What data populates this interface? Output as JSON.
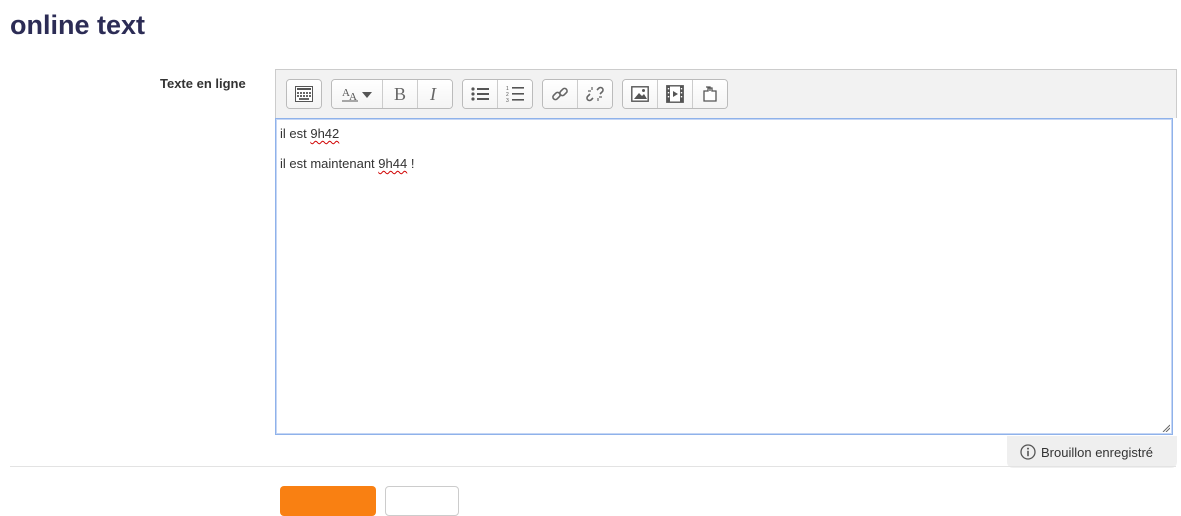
{
  "page": {
    "title": "online text"
  },
  "form": {
    "field_label": "Texte en ligne"
  },
  "editor": {
    "toolbar": [
      {
        "group": "more",
        "buttons": [
          "show-more-buttons-icon"
        ]
      },
      {
        "group": "style",
        "buttons": [
          "paragraph-styles-icon",
          "bold-icon",
          "italic-icon"
        ]
      },
      {
        "group": "list",
        "buttons": [
          "unordered-list-icon",
          "ordered-list-icon"
        ]
      },
      {
        "group": "links",
        "buttons": [
          "link-icon",
          "unlink-icon"
        ]
      },
      {
        "group": "files",
        "buttons": [
          "image-icon",
          "media-icon",
          "manage-files-icon"
        ]
      }
    ],
    "lines": [
      {
        "prefix": "il est ",
        "misspelled": "9h42",
        "suffix": ""
      },
      {
        "prefix": "il est maintenant ",
        "misspelled": "9h44",
        "suffix": " !"
      }
    ]
  },
  "draft": {
    "status": "Brouillon enregistré"
  },
  "colors": {
    "title": "#2c2c55",
    "primary_button": "#f98012",
    "editor_focus_border": "#8fb2ea",
    "spellcheck": "#d00000"
  }
}
